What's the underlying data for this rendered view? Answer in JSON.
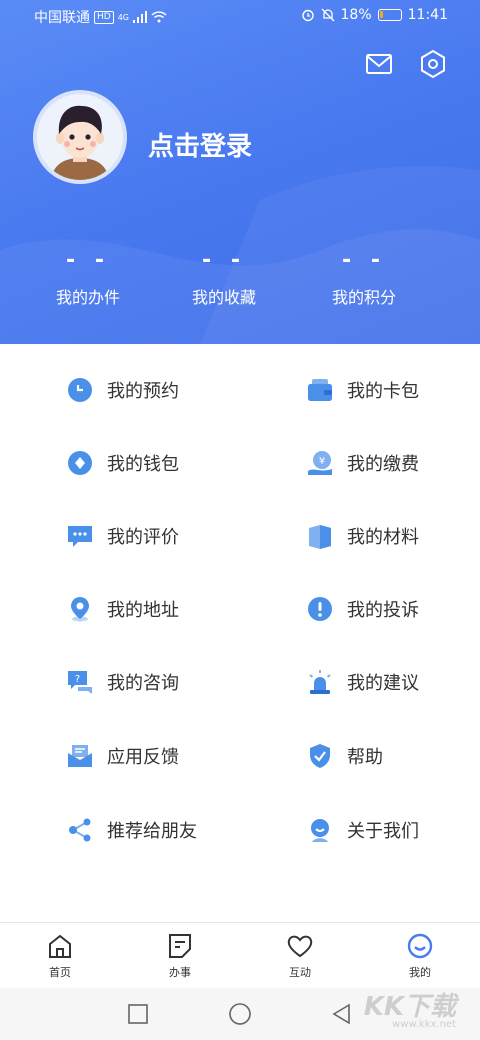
{
  "status_bar": {
    "carrier": "中国联通",
    "hd": "HD",
    "network": "4G",
    "battery": "18%",
    "battery_level": 0.18,
    "time": "11:41"
  },
  "header": {
    "mail_icon": "mail-icon",
    "settings_icon": "settings-icon",
    "login_text": "点击登录"
  },
  "stats": [
    {
      "value": "- -",
      "label": "我的办件"
    },
    {
      "value": "- -",
      "label": "我的收藏"
    },
    {
      "value": "- -",
      "label": "我的积分"
    }
  ],
  "menu": [
    {
      "label": "我的预约",
      "icon": "clock-icon"
    },
    {
      "label": "我的卡包",
      "icon": "card-wallet-icon"
    },
    {
      "label": "我的钱包",
      "icon": "wallet-icon"
    },
    {
      "label": "我的缴费",
      "icon": "payment-icon"
    },
    {
      "label": "我的评价",
      "icon": "comment-icon"
    },
    {
      "label": "我的材料",
      "icon": "materials-icon"
    },
    {
      "label": "我的地址",
      "icon": "location-icon"
    },
    {
      "label": "我的投诉",
      "icon": "complaint-icon"
    },
    {
      "label": "我的咨询",
      "icon": "question-icon"
    },
    {
      "label": "我的建议",
      "icon": "alarm-icon"
    },
    {
      "label": "应用反馈",
      "icon": "envelope-icon"
    },
    {
      "label": "帮助",
      "icon": "shield-icon"
    },
    {
      "label": "推荐给朋友",
      "icon": "share-icon"
    },
    {
      "label": "关于我们",
      "icon": "about-icon"
    }
  ],
  "bottom_nav": [
    {
      "label": "首页",
      "icon": "home-icon"
    },
    {
      "label": "办事",
      "icon": "document-icon"
    },
    {
      "label": "互动",
      "icon": "heart-icon"
    },
    {
      "label": "我的",
      "icon": "smile-icon"
    }
  ],
  "watermark": {
    "text": "KK下载",
    "url": "www.kkx.net"
  },
  "colors": {
    "primary": "#4a7af0",
    "icon_blue": "#4a90e8",
    "text": "#333333"
  }
}
